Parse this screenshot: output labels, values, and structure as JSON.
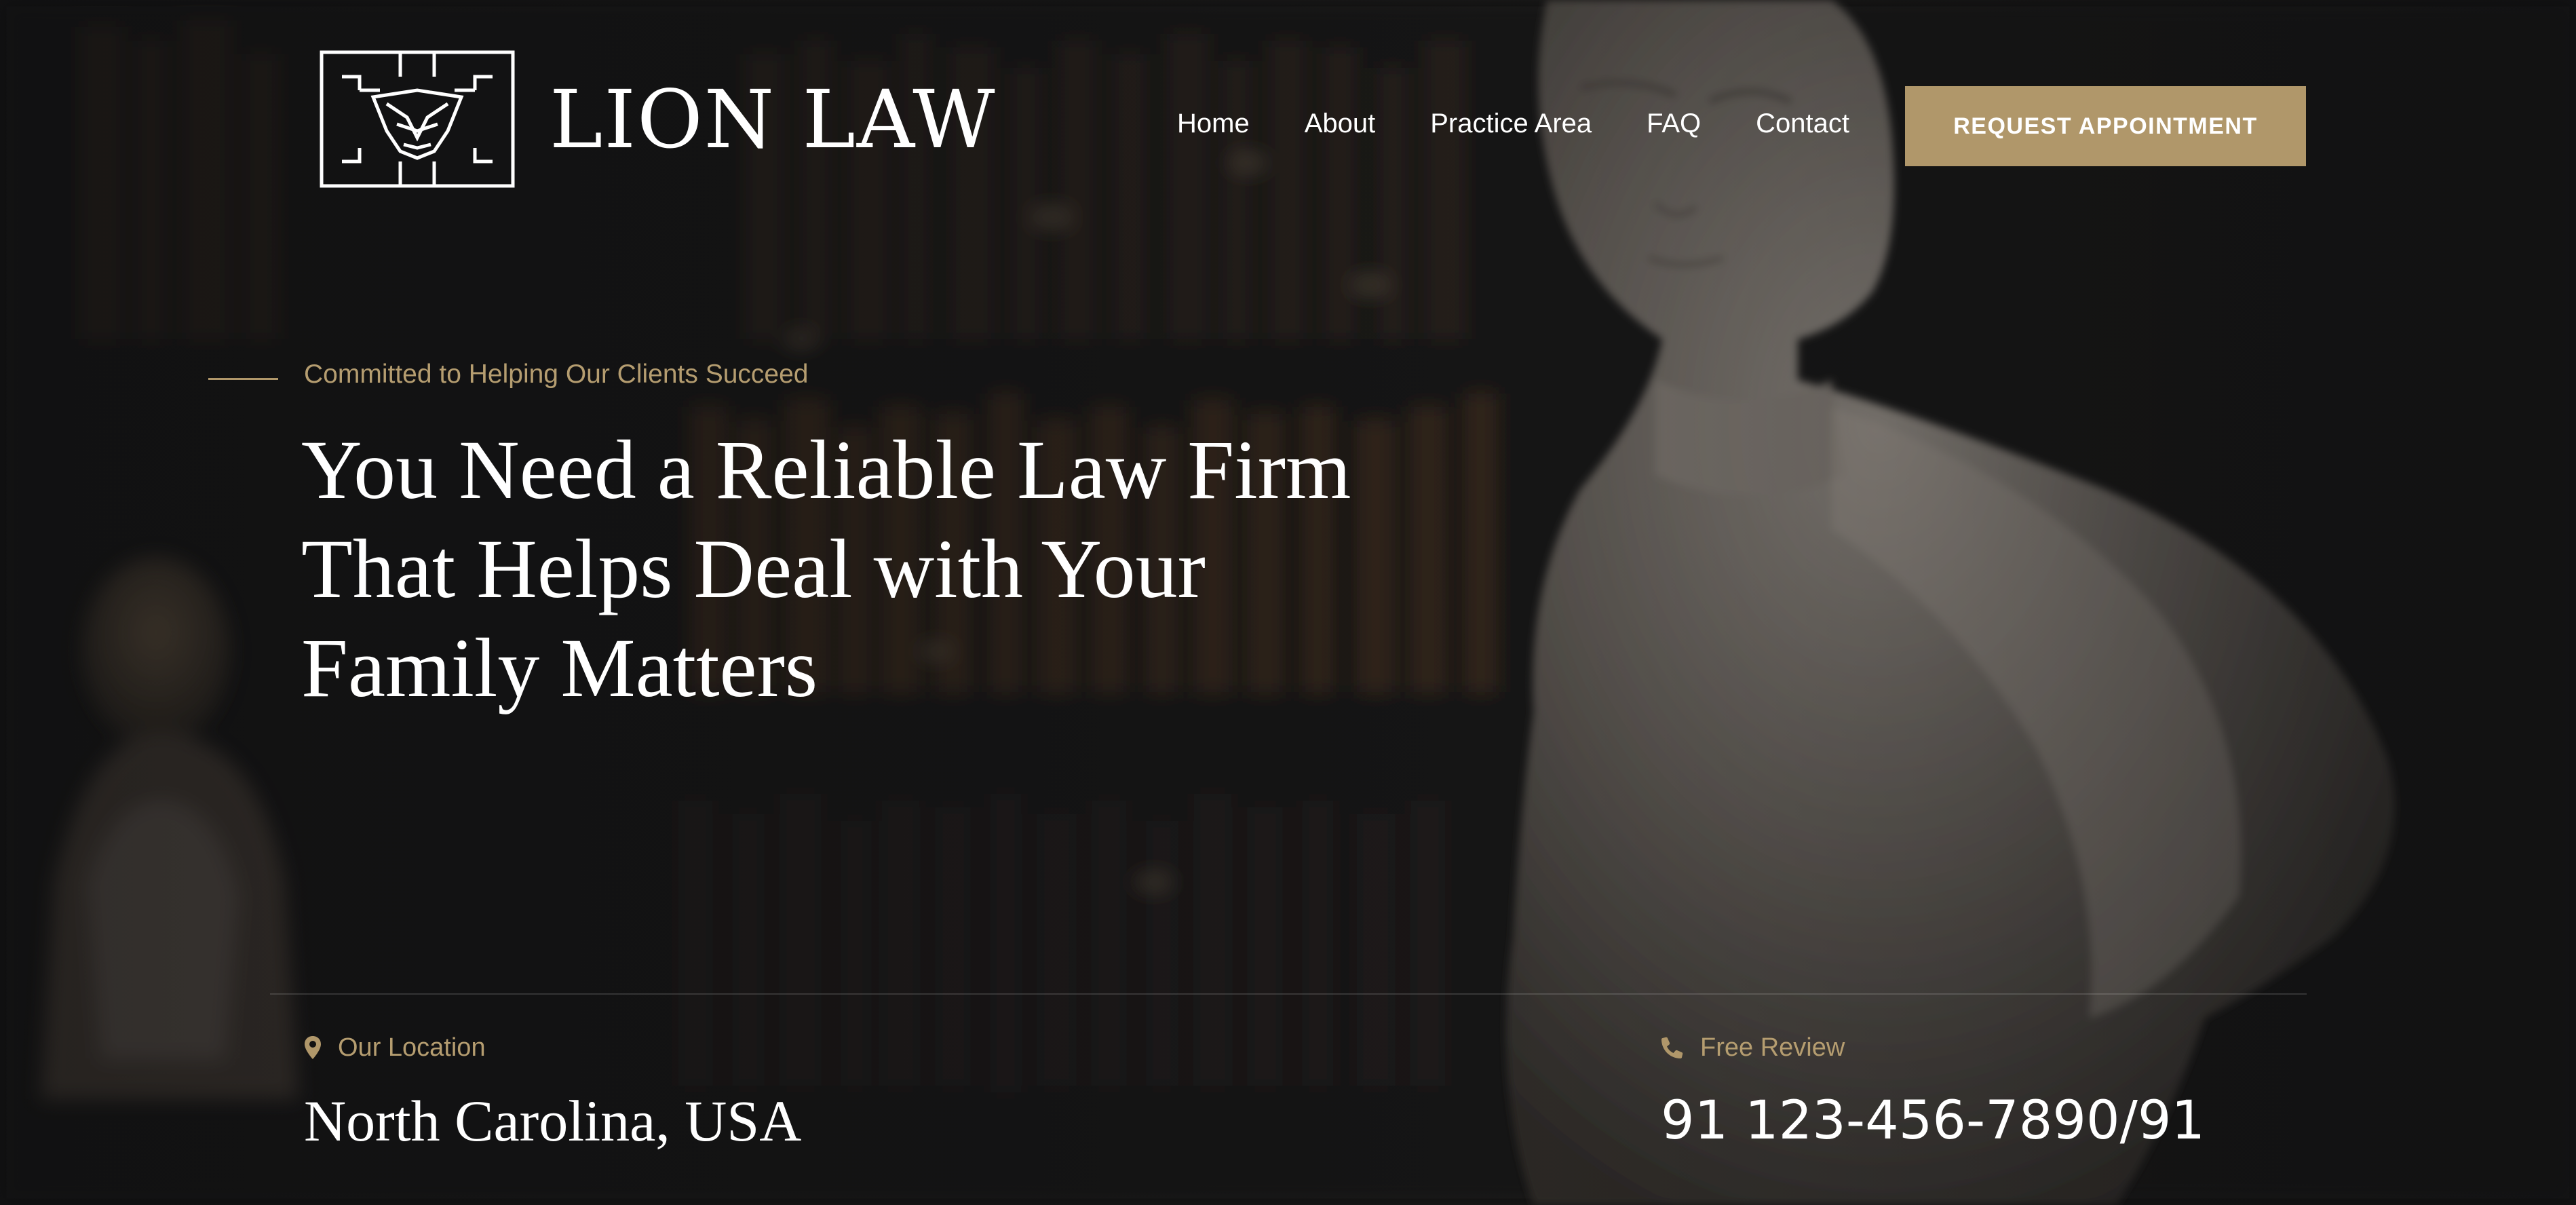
{
  "brand": {
    "name": "LION LAW",
    "accent_color": "#b0976a"
  },
  "nav": {
    "items": [
      {
        "label": "Home"
      },
      {
        "label": "About"
      },
      {
        "label": "Practice Area"
      },
      {
        "label": "FAQ"
      },
      {
        "label": "Contact"
      }
    ],
    "cta_label": "REQUEST APPOINTMENT"
  },
  "hero": {
    "eyebrow": "Committed to Helping Our Clients Succeed",
    "headline_lines": [
      "You Need a Reliable Law Firm",
      "That Helps Deal with Your",
      "Family Matters"
    ]
  },
  "info": {
    "location": {
      "label": "Our Location",
      "value": "North Carolina, USA",
      "icon": "map-pin-icon"
    },
    "phone": {
      "label": "Free Review",
      "value": "91 123-456-7890/91",
      "icon": "phone-icon"
    }
  }
}
